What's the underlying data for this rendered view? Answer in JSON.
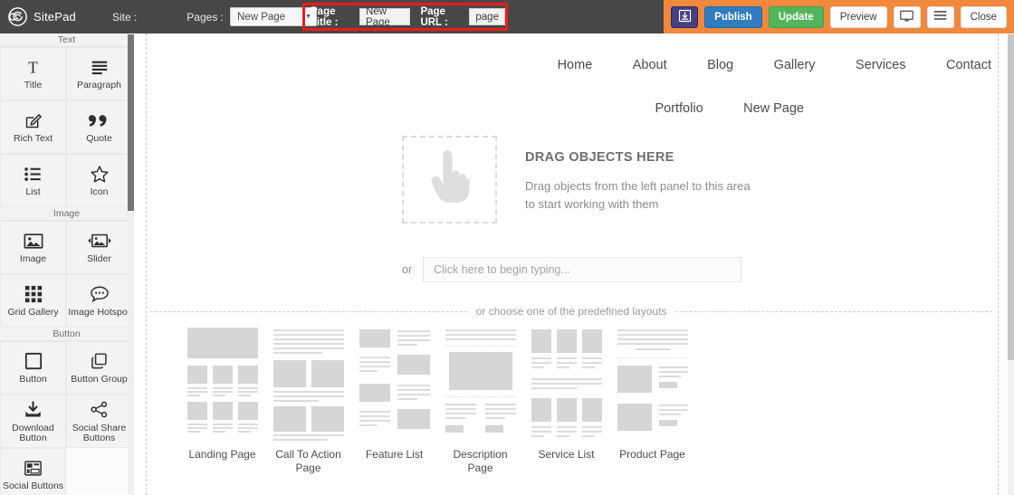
{
  "topbar": {
    "logo_icon": "sitepad-spiral-logo",
    "brand": "SitePad",
    "site_label": "Site :",
    "pages_label": "Pages :",
    "pages_value": "New Page",
    "page_title_label": "Page Title :",
    "page_title_value": "New Page",
    "page_url_label": "Page URL :",
    "page_url_value": "page",
    "highlight_color": "#ee1b16",
    "orange_bg": "#f1883c",
    "buttons": [
      {
        "name": "save-button",
        "label": "",
        "icon": "save-download-icon",
        "color": "#463f86"
      },
      {
        "name": "publish-button",
        "label": "Publish",
        "icon": "",
        "color": "#2f7cc0"
      },
      {
        "name": "update-button",
        "label": "Update",
        "icon": "",
        "color": "#52b45b"
      },
      {
        "name": "preview-button",
        "label": "Preview",
        "icon": "",
        "color": "#fdfdfd"
      },
      {
        "name": "device-button",
        "label": "",
        "icon": "monitor-icon",
        "color": "#fdfdfd"
      },
      {
        "name": "menu-button",
        "label": "",
        "icon": "hamburger-icon",
        "color": "#fdfdfd"
      },
      {
        "name": "close-button",
        "label": "Close",
        "icon": "",
        "color": "#fdfdfd"
      }
    ]
  },
  "sidebar": {
    "sections": [
      {
        "title": "Text",
        "items": [
          {
            "label": "Title",
            "icon": "title-t-icon"
          },
          {
            "label": "Paragraph",
            "icon": "paragraph-lines-icon"
          },
          {
            "label": "Rich Text",
            "icon": "pencil-square-icon"
          },
          {
            "label": "Quote",
            "icon": "quote-marks-icon"
          },
          {
            "label": "List",
            "icon": "bullet-list-icon"
          },
          {
            "label": "Icon",
            "icon": "star-icon"
          }
        ]
      },
      {
        "title": "Image",
        "items": [
          {
            "label": "Image",
            "icon": "picture-icon"
          },
          {
            "label": "Slider",
            "icon": "picture-arrows-icon"
          },
          {
            "label": "Grid Gallery",
            "icon": "grid-dots-icon"
          },
          {
            "label": "Image Hotspot",
            "icon": "speech-bubble-icon"
          }
        ]
      },
      {
        "title": "Button",
        "items": [
          {
            "label": "Download Button",
            "icon": "download-tray-icon"
          },
          {
            "label": "Button",
            "icon": "square-outline-icon"
          },
          {
            "label": "Button Group",
            "icon": "stacked-squares-icon"
          },
          {
            "label": "Social Share Buttons",
            "icon": "share-nodes-icon"
          },
          {
            "label": "Social Buttons",
            "icon": "social-grid-icon"
          }
        ]
      }
    ]
  },
  "canvas": {
    "nav_row1": [
      "Home",
      "About",
      "Blog",
      "Gallery",
      "Services",
      "Contact"
    ],
    "nav_row2": [
      "Portfolio",
      "New Page"
    ],
    "dropzone": {
      "icon": "pointing-hand-icon",
      "title": "DRAG OBJECTS HERE",
      "desc_line1": "Drag objects from the left panel to this area",
      "desc_line2": "to start working with them"
    },
    "or_word": "or",
    "typing_placeholder": "Click here to begin typing...",
    "divider_text": "or choose one of the predefined layouts",
    "layouts": [
      {
        "name": "Landing Page",
        "id": "landing-page"
      },
      {
        "name": "Call To Action Page",
        "id": "call-to-action-page"
      },
      {
        "name": "Feature List",
        "id": "feature-list"
      },
      {
        "name": "Description Page",
        "id": "description-page"
      },
      {
        "name": "Service List",
        "id": "service-list"
      },
      {
        "name": "Product Page",
        "id": "product-page"
      }
    ]
  }
}
